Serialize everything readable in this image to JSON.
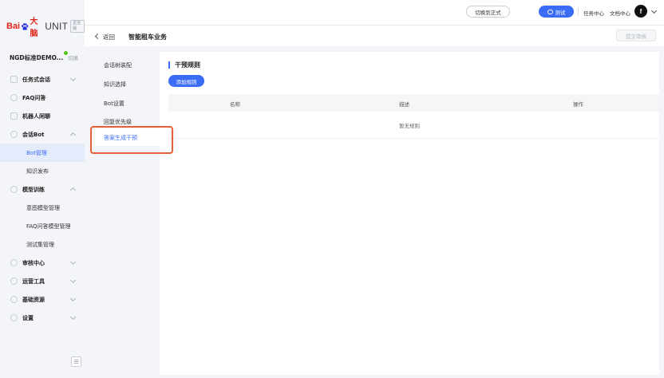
{
  "colors": {
    "accent": "#3b6cf6",
    "highlight_border": "#e45e3a",
    "logo_red": "#e1251b"
  },
  "logo": {
    "bai": "Bai",
    "paw_icon": "baidu-paw-icon",
    "da": "大脑",
    "unit": "UNIT",
    "badge": "企业版"
  },
  "project": {
    "name": "NGD标准DEMO...",
    "switch_label": "切换"
  },
  "sidebar": {
    "items": [
      {
        "label": "任务式会话",
        "icon": "task-dialog-icon",
        "expandable": true,
        "expanded": false
      },
      {
        "label": "FAQ问答",
        "icon": "faq-icon",
        "expandable": false
      },
      {
        "label": "机器人闲聊",
        "icon": "chat-icon",
        "expandable": false
      },
      {
        "label": "会话Bot",
        "icon": "bot-icon",
        "expandable": true,
        "expanded": true,
        "children": [
          {
            "label": "Bot管理",
            "active": true
          },
          {
            "label": "知识发布",
            "active": false
          }
        ]
      },
      {
        "label": "模型训练",
        "icon": "model-icon",
        "expandable": true,
        "expanded": true,
        "children": [
          {
            "label": "意图模型管理"
          },
          {
            "label": "FAQ问答模型管理"
          },
          {
            "label": "测试集管理"
          }
        ]
      },
      {
        "label": "审核中心",
        "icon": "review-icon",
        "expandable": true,
        "expanded": false
      },
      {
        "label": "运营工具",
        "icon": "ops-icon",
        "expandable": true,
        "expanded": false
      },
      {
        "label": "基础资源",
        "icon": "resource-icon",
        "expandable": true,
        "expanded": false
      },
      {
        "label": "设置",
        "icon": "settings-icon",
        "expandable": true,
        "expanded": false
      }
    ],
    "collapse_icon": "collapse-sidebar-icon"
  },
  "topbar": {
    "switch_env_label": "切换到正式",
    "test_label": "测试",
    "task_center": "任务中心",
    "doc_center": "文档中心",
    "avatar_letter": "f"
  },
  "subheader": {
    "back_label": "返回",
    "business_name": "智能租车业务",
    "submit_label": "提交审核"
  },
  "config_menu": {
    "items": [
      "会话树装配",
      "知识选择",
      "Bot设置",
      "回复优先级",
      "答案生成干预"
    ],
    "active_index": 4
  },
  "main": {
    "section_title": "干预规则",
    "add_button": "添加规则",
    "table": {
      "columns": [
        "名称",
        "描述",
        "操作"
      ],
      "rows": [],
      "empty_text": "暂无规则"
    }
  }
}
